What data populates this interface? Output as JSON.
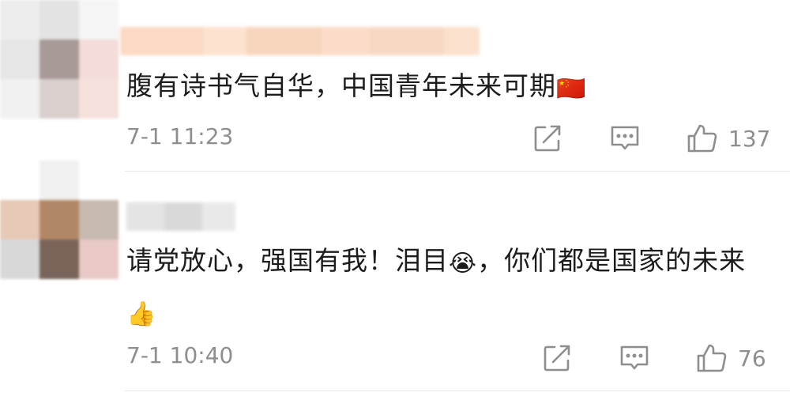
{
  "comments": [
    {
      "text": "腹有诗书气自华，中国青年未来可期",
      "emoji": "🇨🇳",
      "time": "7-1 11:23",
      "likes": "137",
      "avatar_colors": [
        "#ededed",
        "#e3e3e3",
        "#f5f5f5",
        "#e6e6e6",
        "#a89a96",
        "#f3dcd9",
        "#f1f1f1",
        "#d9d0ce",
        "#f6e0dc"
      ],
      "name_colors": [
        "#fbd9c2",
        "#fde2cf",
        "#f8d5bd",
        "#fcdcc8",
        "#f9d8c3",
        "#fbe1cd"
      ]
    },
    {
      "text_before_emoji": "请党放心，强国有我！泪目",
      "emoji_mid": "😭",
      "text_after_emoji": "，你们都是国家的未来",
      "emoji_end": "👍",
      "time": "7-1 10:40",
      "likes": "76",
      "avatar_colors": [
        "#ffffff",
        "#f0f0f0",
        "#ffffff",
        "#e6c9b6",
        "#b28765",
        "#c7bab1",
        "#d8d8d8",
        "#7a6459",
        "#e8c9c6"
      ],
      "name_colors": [
        "#e4e4e4",
        "#d9d9d9",
        "#e9e9e9"
      ]
    }
  ],
  "icons": {
    "share": "share-icon",
    "reply": "reply-icon",
    "like": "thumbs-up-icon"
  },
  "colors": {
    "text": "#1c1c1c",
    "meta": "#8e8e8e",
    "divider": "#e8e8e8"
  }
}
